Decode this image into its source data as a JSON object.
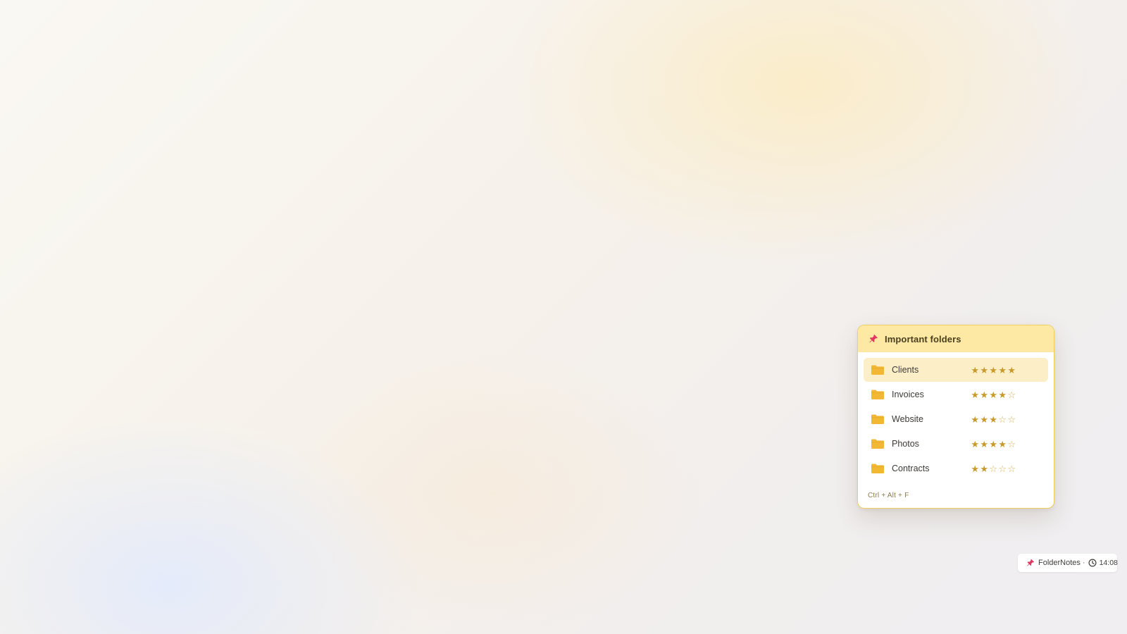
{
  "widget": {
    "title": "Important folders",
    "icon": "pin-icon",
    "shortcut": "Ctrl + Alt + F",
    "folders": [
      {
        "name": "Clients",
        "rating": 5,
        "max_rating": 5,
        "selected": true
      },
      {
        "name": "Invoices",
        "rating": 4,
        "max_rating": 5,
        "selected": false
      },
      {
        "name": "Website",
        "rating": 3,
        "max_rating": 5,
        "selected": false
      },
      {
        "name": "Photos",
        "rating": 4,
        "max_rating": 5,
        "selected": false
      },
      {
        "name": "Contracts",
        "rating": 2,
        "max_rating": 5,
        "selected": false
      }
    ]
  },
  "tray": {
    "app_name": "FolderNotes",
    "separator": "·",
    "time": "14:08",
    "icons": [
      "pin-icon",
      "clock-icon"
    ]
  },
  "colors": {
    "header_background": "#fde9a4",
    "widget_border": "#f0cf5e",
    "selected_row": "#fcefc8",
    "folder_icon": "#f2b733",
    "star": "#c89a2c",
    "pin_icon": "#e0385f"
  }
}
